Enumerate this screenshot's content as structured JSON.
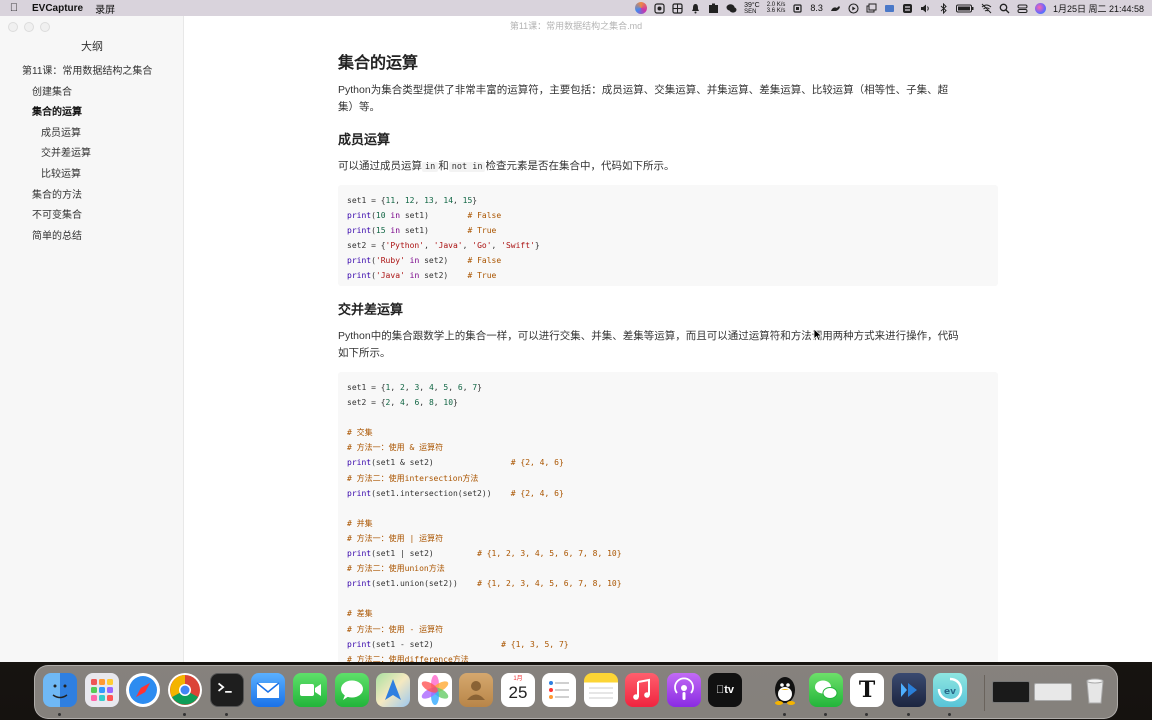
{
  "menubar": {
    "app_name": "EVCapture",
    "menu_item": "录屏",
    "temperature": "39°C",
    "sensor_label": "SEN",
    "net_up": "2.0 K/s",
    "net_down": "3.6 K/s",
    "cpu_reading": "8.3",
    "datetime": "1月25日 周二  21:44:58"
  },
  "window": {
    "title": "第11课：常用数据结构之集合.md"
  },
  "sidebar": {
    "title": "大纲",
    "items": [
      {
        "label": "第11课：常用数据结构之集合",
        "level": 1,
        "active": false
      },
      {
        "label": "创建集合",
        "level": 2,
        "active": false
      },
      {
        "label": "集合的运算",
        "level": 2,
        "active": true
      },
      {
        "label": "成员运算",
        "level": 3,
        "active": false
      },
      {
        "label": "交并差运算",
        "level": 3,
        "active": false
      },
      {
        "label": "比较运算",
        "level": 3,
        "active": false
      },
      {
        "label": "集合的方法",
        "level": 2,
        "active": false
      },
      {
        "label": "不可变集合",
        "level": 2,
        "active": false
      },
      {
        "label": "简单的总结",
        "level": 2,
        "active": false
      }
    ]
  },
  "content": {
    "heading": "集合的运算",
    "intro_line1": "Python为集合类型提供了非常丰富的运算符，主要包括：成员运算、交集运算、并集运算、差集运算、比较运算（相等性、子集、超",
    "intro_line2": "集）等。",
    "member_heading": "成员运算",
    "member_text_a": "可以通过成员运算",
    "member_code_in": "in",
    "member_text_b": "和",
    "member_code_notin": "not in",
    "member_text_c": "检查元素是否在集合中，代码如下所示。",
    "member_code": [
      "set1 = {11, 12, 13, 14, 15}",
      "print(10 in set1)        # False",
      "print(15 in set1)        # True",
      "set2 = {'Python', 'Java', 'Go', 'Swift'}",
      "print('Ruby' in set2)    # False",
      "print('Java' in set2)    # True"
    ],
    "setops_heading": "交并差运算",
    "setops_line1": "Python中的集合跟数学上的集合一样，可以进行交集、并集、差集等运算，而且可以通过运算符和方法调用两种方式来进行操作，代码",
    "setops_line2": "如下所示。",
    "setops_code": [
      "set1 = {1, 2, 3, 4, 5, 6, 7}",
      "set2 = {2, 4, 6, 8, 10}",
      "",
      "# 交集",
      "# 方法一：使用 & 运算符",
      "print(set1 & set2)                # {2, 4, 6}",
      "# 方法二：使用intersection方法",
      "print(set1.intersection(set2))    # {2, 4, 6}",
      "",
      "# 并集",
      "# 方法一：使用 | 运算符",
      "print(set1 | set2)         # {1, 2, 3, 4, 5, 6, 7, 8, 10}",
      "# 方法二：使用union方法",
      "print(set1.union(set2))    # {1, 2, 3, 4, 5, 6, 7, 8, 10}",
      "",
      "# 差集",
      "# 方法一：使用 - 运算符",
      "print(set1 - set2)              # {1, 3, 5, 7}",
      "# 方法二：使用difference方法"
    ]
  },
  "dock": {
    "calendar_month": "1月",
    "calendar_day": "25",
    "apps": [
      "finder-icon",
      "launchpad-icon",
      "safari-icon",
      "chrome-icon",
      "terminal-icon",
      "mail-icon",
      "facetime-icon",
      "messages-icon",
      "maps-icon",
      "photos-icon",
      "contacts-icon",
      "calendar-icon",
      "reminders-icon",
      "notes-icon",
      "music-icon",
      "podcasts-icon",
      "apple-tv-icon",
      "qq-icon",
      "wechat-icon",
      "typora-icon",
      "evcapture-icon",
      "ev-recorder-icon"
    ]
  }
}
